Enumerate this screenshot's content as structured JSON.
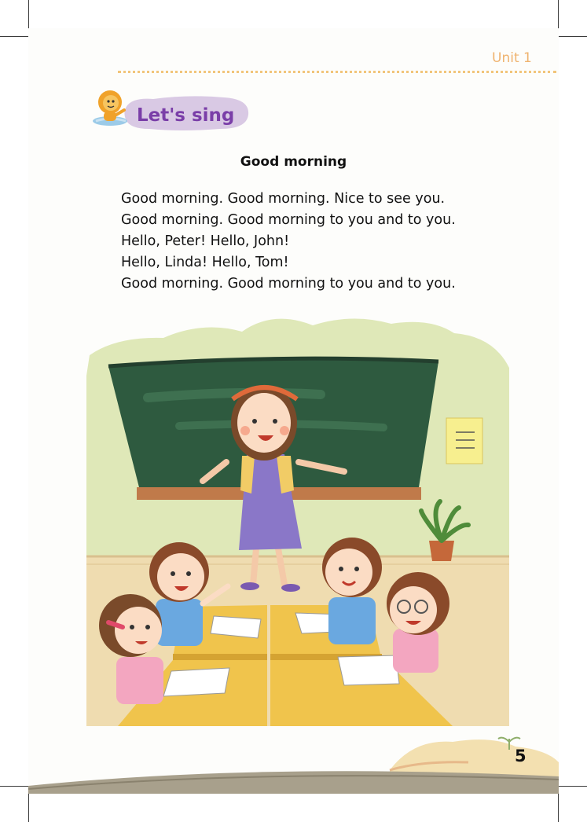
{
  "header": {
    "unit_label": "Unit 1"
  },
  "section": {
    "label": "Let's sing"
  },
  "song": {
    "title": "Good morning",
    "lines": [
      "Good morning. Good morning. Nice to see you.",
      "Good morning. Good morning to you and to you.",
      "Hello, Peter! Hello, John!",
      "Hello, Linda! Hello, Tom!",
      "Good morning. Good morning to you and to you."
    ]
  },
  "footer": {
    "page_number": "5"
  },
  "colors": {
    "accent": "#efb36f",
    "section_purple": "#7a3ea8",
    "chalkboard": "#2e5a3f",
    "desk": "#f0c44c"
  }
}
